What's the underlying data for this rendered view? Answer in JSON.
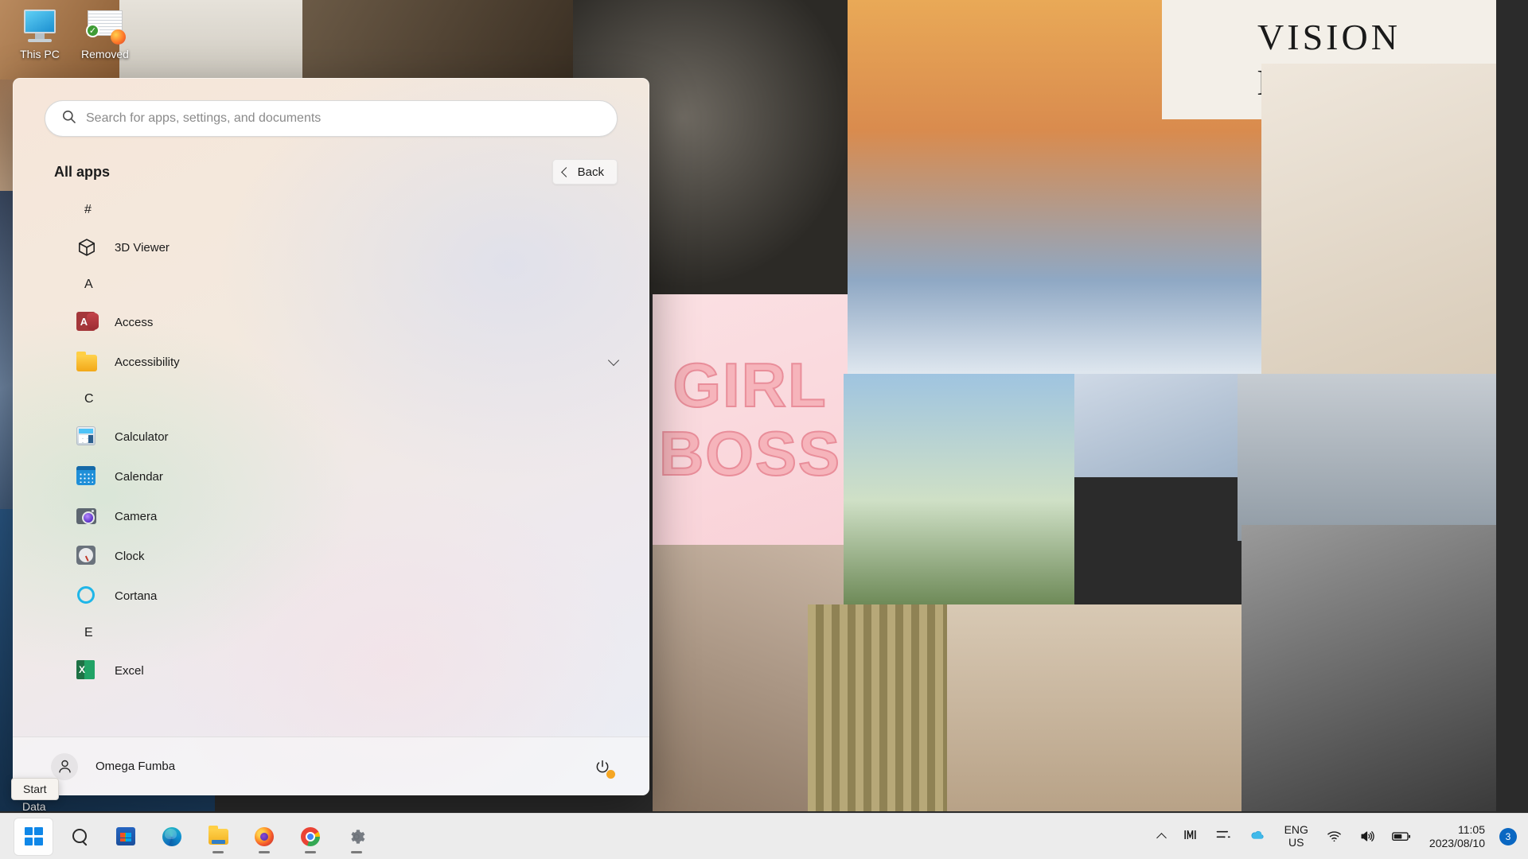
{
  "desktop": {
    "icons": [
      {
        "label": "This PC",
        "icon": "monitor-icon"
      },
      {
        "label": "Removed",
        "icon": "document-firefox-icon"
      }
    ],
    "data_label": "Data",
    "wallpaper_texts": {
      "vision": "VISION",
      "board": "BOARD",
      "girl": "GIRL",
      "boss": "BOSS"
    }
  },
  "start_menu": {
    "search": {
      "placeholder": "Search for apps, settings, and documents",
      "value": "",
      "icon": "search-icon"
    },
    "all_apps_title": "All apps",
    "back_button": {
      "label": "Back",
      "icon": "chevron-left-icon"
    },
    "sections": [
      {
        "letter": "#",
        "apps": [
          {
            "label": "3D Viewer",
            "icon": "cube-icon",
            "expandable": false
          }
        ]
      },
      {
        "letter": "A",
        "apps": [
          {
            "label": "Access",
            "icon": "access-icon",
            "expandable": false
          },
          {
            "label": "Accessibility",
            "icon": "folder-icon",
            "expandable": true
          }
        ]
      },
      {
        "letter": "C",
        "apps": [
          {
            "label": "Calculator",
            "icon": "calculator-icon",
            "expandable": false
          },
          {
            "label": "Calendar",
            "icon": "calendar-icon",
            "expandable": false
          },
          {
            "label": "Camera",
            "icon": "camera-icon",
            "expandable": false
          },
          {
            "label": "Clock",
            "icon": "clock-icon",
            "expandable": false
          },
          {
            "label": "Cortana",
            "icon": "cortana-icon",
            "expandable": false
          }
        ]
      },
      {
        "letter": "E",
        "apps": [
          {
            "label": "Excel",
            "icon": "excel-icon",
            "expandable": false
          }
        ]
      }
    ],
    "footer": {
      "user_name": "Omega Fumba",
      "user_icon": "person-icon",
      "power_icon": "power-icon",
      "power_update_pending": true
    }
  },
  "tooltip": {
    "label": "Start"
  },
  "taskbar": {
    "buttons": [
      {
        "name": "start",
        "label": "Start",
        "icon": "windows-logo-icon",
        "active": true,
        "running": false
      },
      {
        "name": "search",
        "label": "Search",
        "icon": "search-icon",
        "active": false,
        "running": false
      },
      {
        "name": "store",
        "label": "Microsoft Store",
        "icon": "store-icon",
        "active": false,
        "running": false
      },
      {
        "name": "edge",
        "label": "Microsoft Edge",
        "icon": "edge-icon",
        "active": false,
        "running": false
      },
      {
        "name": "file-explorer",
        "label": "File Explorer",
        "icon": "folder-icon",
        "active": false,
        "running": true
      },
      {
        "name": "firefox",
        "label": "Firefox",
        "icon": "firefox-icon",
        "active": false,
        "running": true
      },
      {
        "name": "chrome",
        "label": "Google Chrome",
        "icon": "chrome-icon",
        "active": false,
        "running": true
      },
      {
        "name": "settings",
        "label": "Settings",
        "icon": "gear-icon",
        "active": false,
        "running": true
      }
    ],
    "tray": {
      "hidden_icons": {
        "icon": "chevron-up-icon"
      },
      "meet_now": {
        "icon": "meet-now-icon"
      },
      "equalizer": {
        "icon": "audio-sliders-icon"
      },
      "onedrive": {
        "icon": "onedrive-icon"
      },
      "language_line1": "ENG",
      "language_line2": "US",
      "network": {
        "icon": "wifi-icon"
      },
      "volume": {
        "icon": "speaker-icon"
      },
      "battery": {
        "icon": "battery-icon"
      },
      "time": "11:05",
      "date": "2023/08/10",
      "notification_count": "3"
    }
  },
  "colors": {
    "accent": "#0a67c2",
    "taskbar_bg": "#f3f3f3",
    "power_pending": "#f5a623"
  }
}
